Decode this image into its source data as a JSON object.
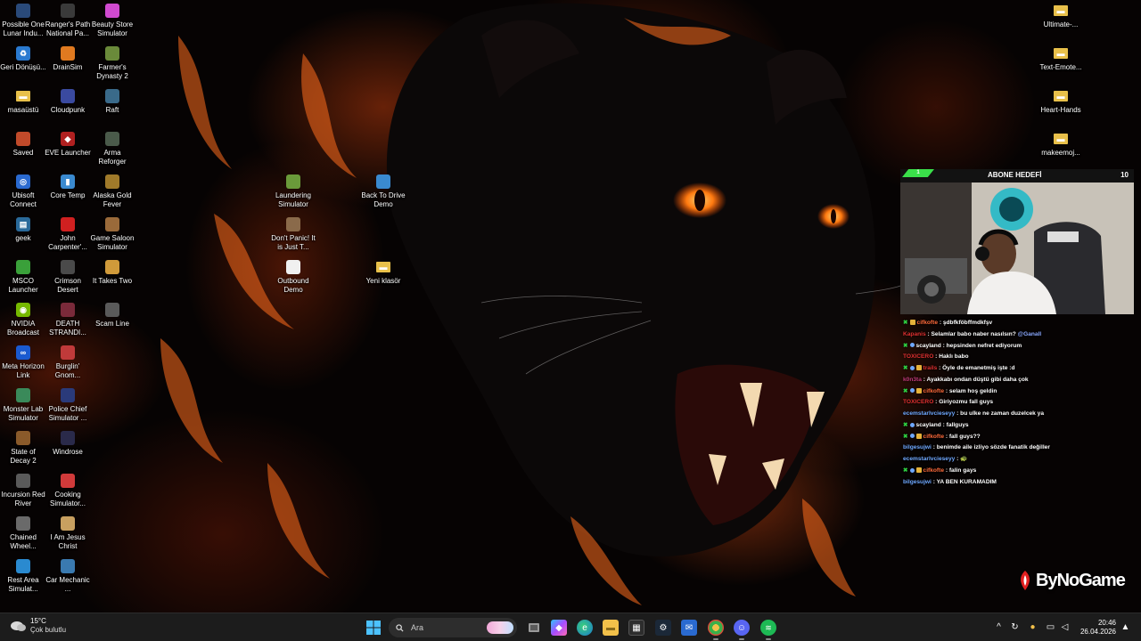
{
  "desktop_icons": [
    {
      "label": "Possible One Lunar Indu...",
      "icon": "game-icon",
      "color": "#2a4a7a"
    },
    {
      "label": "Ranger's Path National Pa...",
      "icon": "game-icon",
      "color": "#3a3a3a"
    },
    {
      "label": "Beauty Store Simulator",
      "icon": "game-icon",
      "color": "#d04ad0"
    },
    {
      "label": "Geri Dönüşü...",
      "icon": "recycle-bin-icon",
      "color": "#2a7ad0"
    },
    {
      "label": "DrainSim",
      "icon": "game-icon",
      "color": "#e07a20"
    },
    {
      "label": "Farmer's Dynasty 2",
      "icon": "game-icon",
      "color": "#6a8a3a"
    },
    {
      "label": "masaüstü",
      "icon": "folder-icon",
      "color": "#e8c04a"
    },
    {
      "label": "Cloudpunk",
      "icon": "game-icon",
      "color": "#3a4aa0"
    },
    {
      "label": "Raft",
      "icon": "game-icon",
      "color": "#3a6a8a"
    },
    {
      "label": "Saved",
      "icon": "game-icon",
      "color": "#c04a2a"
    },
    {
      "label": "EVE Launcher",
      "icon": "launcher-icon",
      "color": "#b02020"
    },
    {
      "label": "Arma Reforger",
      "icon": "game-icon",
      "color": "#4a5a4a"
    },
    {
      "label": "Ubisoft Connect",
      "icon": "ubisoft-icon",
      "color": "#2a6ad0"
    },
    {
      "label": "Core Temp",
      "icon": "thermometer-icon",
      "color": "#3a8ad0"
    },
    {
      "label": "Alaska Gold Fever",
      "icon": "game-icon",
      "color": "#a07a2a"
    },
    {
      "label": "geek",
      "icon": "app-icon",
      "color": "#2a6a9a"
    },
    {
      "label": "John Carpenter'...",
      "icon": "game-icon",
      "color": "#d02020"
    },
    {
      "label": "Game Saloon Simulator",
      "icon": "game-icon",
      "color": "#9a6a3a"
    },
    {
      "label": "MSCO Launcher",
      "icon": "game-icon",
      "color": "#3aa03a"
    },
    {
      "label": "Crimson Desert",
      "icon": "game-icon",
      "color": "#4a4a4a"
    },
    {
      "label": "It Takes Two",
      "icon": "game-icon",
      "color": "#d09a3a"
    },
    {
      "label": "NVIDIA Broadcast",
      "icon": "nvidia-icon",
      "color": "#76b900"
    },
    {
      "label": "DEATH STRANDI...",
      "icon": "game-icon",
      "color": "#7a2a3a"
    },
    {
      "label": "Scam Line",
      "icon": "game-icon",
      "color": "#5a5a5a"
    },
    {
      "label": "Meta Horizon Link",
      "icon": "meta-icon",
      "color": "#1a5ad0"
    },
    {
      "label": "Burglin' Gnom...",
      "icon": "game-icon",
      "color": "#c03a3a"
    },
    {
      "label": "Monster Lab Simulator",
      "icon": "game-icon",
      "color": "#3a8a5a"
    },
    {
      "label": "Police Chief Simulator ...",
      "icon": "game-icon",
      "color": "#2a3a7a"
    },
    {
      "label": "State of Decay 2",
      "icon": "game-icon",
      "color": "#8a5a2a"
    },
    {
      "label": "Windrose",
      "icon": "game-icon",
      "color": "#2a2a4a"
    },
    {
      "label": "Incursion Red River",
      "icon": "game-icon",
      "color": "#5a5a5a"
    },
    {
      "label": "Cooking Simulator...",
      "icon": "game-icon",
      "color": "#d03a3a"
    },
    {
      "label": "Chained Wheel...",
      "icon": "game-icon",
      "color": "#6a6a6a"
    },
    {
      "label": "I Am Jesus Christ",
      "icon": "game-icon",
      "color": "#c8a060"
    },
    {
      "label": "Rest Area Simulat...",
      "icon": "game-icon",
      "color": "#2a8ad0"
    },
    {
      "label": "Car Mechanic ...",
      "icon": "game-icon",
      "color": "#3a7ab0"
    },
    {
      "label": "Laundering Simulator",
      "icon": "game-icon",
      "color": "#6a9a3a"
    },
    {
      "label": "Back To Drive Demo",
      "icon": "game-icon",
      "color": "#3a8ad0"
    },
    {
      "label": "Don't Panic! It is Just T...",
      "icon": "game-icon",
      "color": "#8a6a4a"
    },
    {
      "label": "Outbound Demo",
      "icon": "game-icon",
      "color": "#f0f0f0"
    },
    {
      "label": "Yeni klasör",
      "icon": "folder-icon",
      "color": "#e8c04a"
    },
    {
      "label": "Ultimate-...",
      "icon": "folder-icon",
      "color": "#e8c04a"
    },
    {
      "label": "Text-Emote...",
      "icon": "folder-icon",
      "color": "#e8c04a"
    },
    {
      "label": "Heart-Hands",
      "icon": "folder-icon",
      "color": "#e8c04a"
    },
    {
      "label": "makeemoj...",
      "icon": "folder-icon",
      "color": "#e8c04a"
    }
  ],
  "stream_overlay": {
    "goal_title": "ABONE HEDEFİ",
    "goal_current": "1",
    "goal_target": "10",
    "goal_fraction": 0.1,
    "accent": "#3ae04a"
  },
  "chat": [
    {
      "user": "cifkofte",
      "color": "#ff6a3a",
      "badges": "mod-sub",
      "message": "şdbfkföbffmdkfşv",
      "mention": ""
    },
    {
      "user": "Kapanis",
      "color": "#e03030",
      "badges": "none",
      "message": "Selamlar babo naber nasılsın?",
      "mention": "@Ganall"
    },
    {
      "user": "scayland",
      "color": "#ffffff",
      "badges": "mod-star",
      "message": "hepsinden nefret ediyorum",
      "mention": ""
    },
    {
      "user": "TOXICERO",
      "color": "#e03030",
      "badges": "none",
      "message": "Haklı babo",
      "mention": ""
    },
    {
      "user": "trails",
      "color": "#e03030",
      "badges": "mod-dot-sub",
      "message": "Öyle de emanetmiş işte :d",
      "mention": ""
    },
    {
      "user": "k0n3ta",
      "color": "#c03a7a",
      "badges": "none",
      "message": "Ayakkabı ondan düştü gibi daha çok",
      "mention": ""
    },
    {
      "user": "cifkofte",
      "color": "#ff6a3a",
      "badges": "mod-dot-sub",
      "message": "selam hoş geldin",
      "mention": ""
    },
    {
      "user": "TOXICERO",
      "color": "#e03030",
      "badges": "none",
      "message": "Giriyozmu fall guys",
      "mention": ""
    },
    {
      "user": "ecemstarlvcieseyy",
      "color": "#6fa8ff",
      "badges": "none",
      "message": "bu ulke ne zaman duzelcek ya",
      "mention": ""
    },
    {
      "user": "scayland",
      "color": "#ffffff",
      "badges": "mod-star",
      "message": "fallguys",
      "mention": ""
    },
    {
      "user": "cifkofte",
      "color": "#ff6a3a",
      "badges": "mod-dot-sub",
      "message": "fall guys??",
      "mention": ""
    },
    {
      "user": "bilgesujwi",
      "color": "#6fa8ff",
      "badges": "none",
      "message": "benimde aile izliyo sözde fanatik değiller",
      "mention": ""
    },
    {
      "user": "ecemstarlvcieseyy",
      "color": "#6fa8ff",
      "badges": "none",
      "message": "🐢",
      "mention": ""
    },
    {
      "user": "cifkofte",
      "color": "#ff6a3a",
      "badges": "mod-dot-sub",
      "message": "falin gays",
      "mention": ""
    },
    {
      "user": "bilgesujwi",
      "color": "#6fa8ff",
      "badges": "none",
      "message": "YA BEN KURAMADIM",
      "mention": ""
    }
  ],
  "watermark": {
    "text": "ByNoGame"
  },
  "taskbar": {
    "weather_temp": "15°C",
    "weather_desc": "Çok bulutlu",
    "search_placeholder": "Ara",
    "time": "20:46",
    "date": "26.04.2026"
  }
}
